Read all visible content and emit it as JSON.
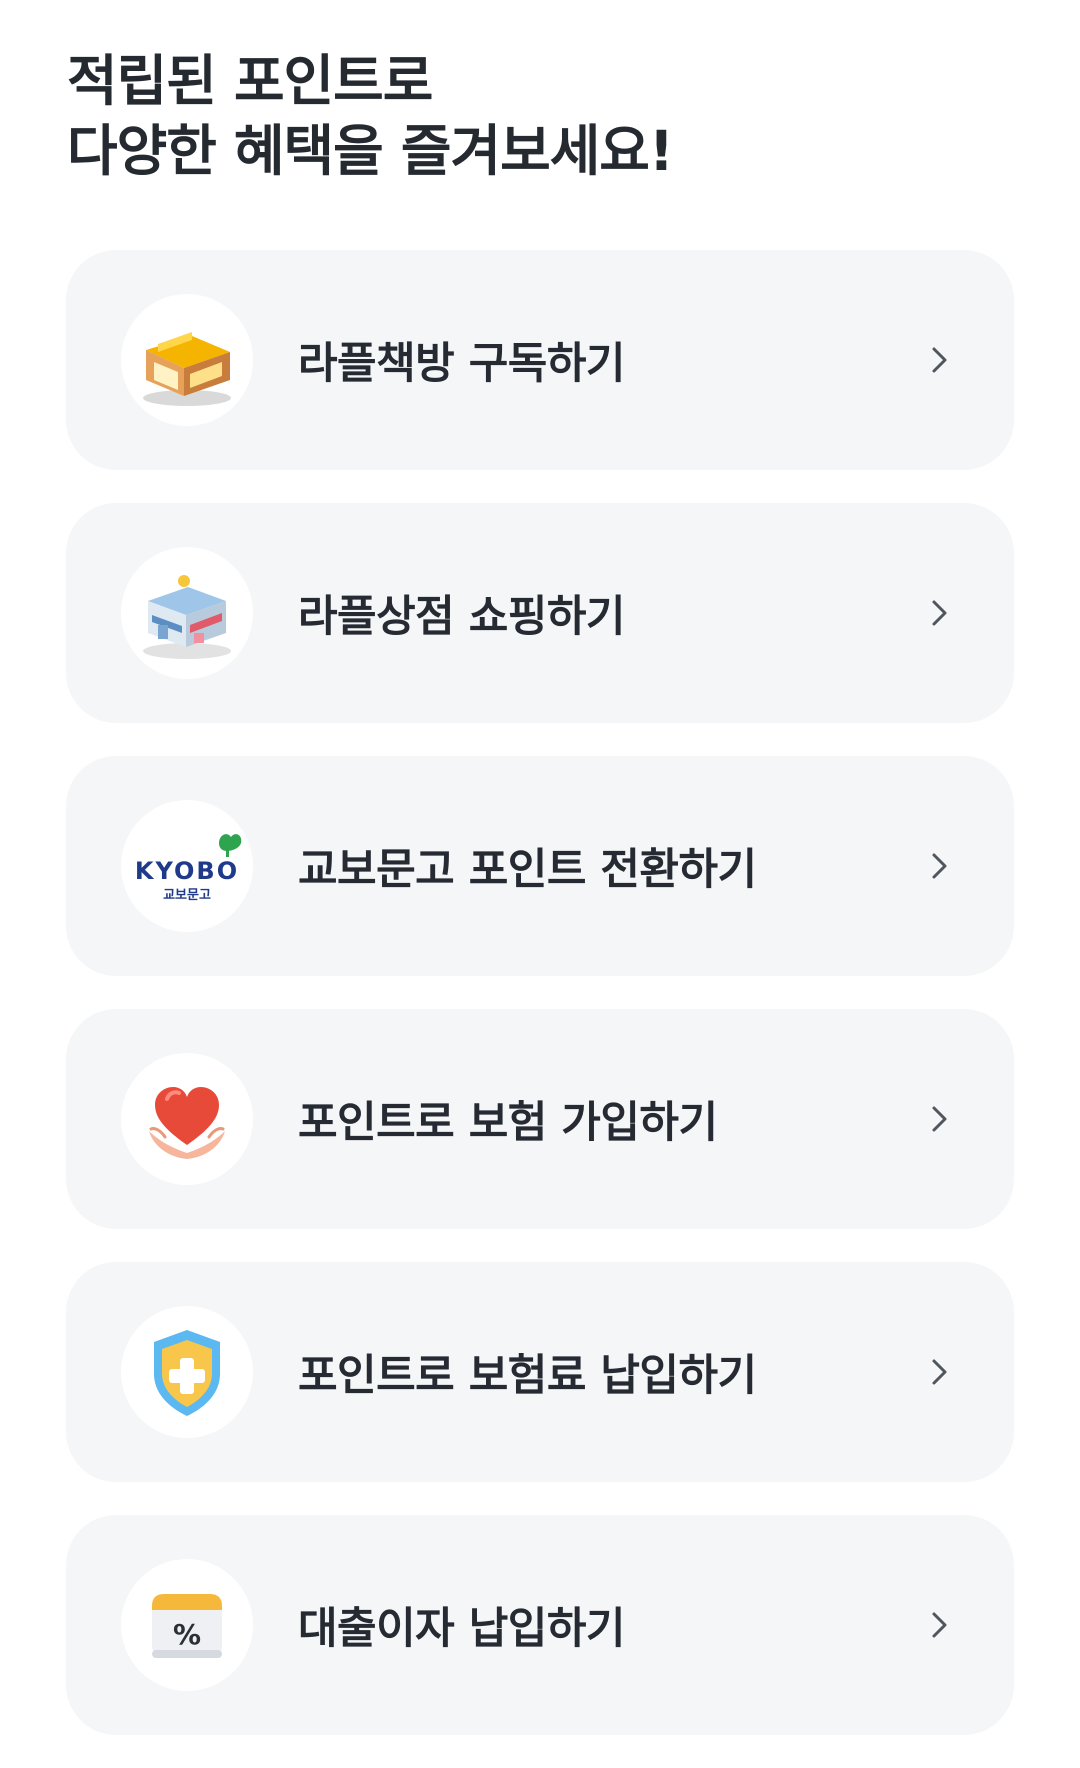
{
  "header": {
    "title_line1": "적립된 포인트로",
    "title_line2": "다양한 혜택을 즐겨보세요!"
  },
  "items": [
    {
      "label": "라플책방 구독하기",
      "icon": "bookstore-building-icon"
    },
    {
      "label": "라플상점 쇼핑하기",
      "icon": "shop-building-icon"
    },
    {
      "label": "교보문고 포인트 전환하기",
      "icon": "kyobo-logo-icon",
      "logo_text": "KYOBO",
      "logo_subtext": "교보문고"
    },
    {
      "label": "포인트로 보험 가입하기",
      "icon": "heart-in-hands-icon"
    },
    {
      "label": "포인트로 보험료 납입하기",
      "icon": "shield-plus-icon"
    },
    {
      "label": "대출이자 납입하기",
      "icon": "percent-calendar-icon",
      "icon_text": "%"
    }
  ],
  "colors": {
    "card_bg": "#f5f6f7",
    "text": "#262b33",
    "chevron": "#50565e",
    "kyobo_blue": "#1f3a8a",
    "kyobo_green": "#2ea44f",
    "shield_blue": "#5bb8f0",
    "shield_yellow": "#f7c64a",
    "heart_red": "#e84a3a"
  }
}
